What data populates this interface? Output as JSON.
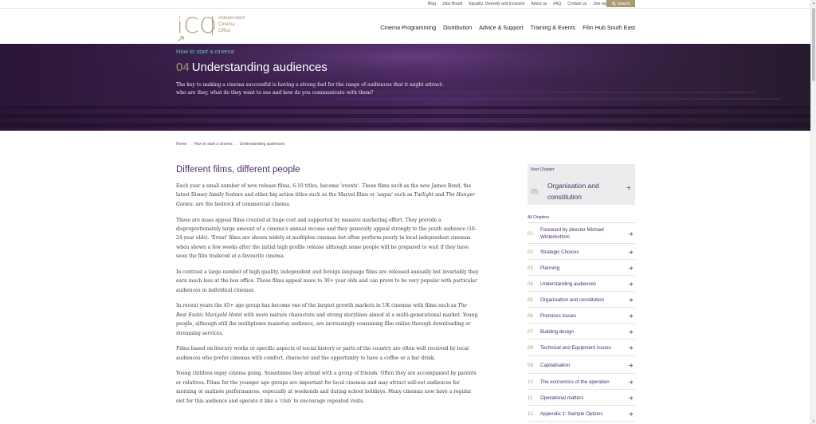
{
  "utility": {
    "links": [
      "Blog",
      "Jobs Board",
      "Equality, Diversity and Inclusion",
      "About us",
      "FAQ",
      "Contact us",
      "Join our Newsletter"
    ],
    "search_label": "Search"
  },
  "logo": {
    "mark": "iCO",
    "line1": "Independent",
    "line2": "Cinema",
    "line3": "Office"
  },
  "nav": [
    "Cinema Programming",
    "Distribution",
    "Advice & Support",
    "Training & Events",
    "Film Hub South East"
  ],
  "hero": {
    "section": "How to start a cinema",
    "number": "04",
    "title": "Understanding audiences",
    "description": "The key to making a cinema successful is having a strong feel for the range of audiences that it might attract: who are they, what do they want to see and how do you communicate with them?"
  },
  "breadcrumb": {
    "home": "Home",
    "section": "How to start a cinema",
    "current": "Understanding audiences",
    "arrow": "→"
  },
  "article": {
    "heading": "Different films, different people",
    "p1a": "Each year a small number of new release films, 6-10 titles, become 'events'.  These films such as the new James Bond, the latest Disney family feature and other big action titles such as the Marvel films or 'sagas' such as ",
    "p1_em1": "Twilight",
    "p1b": " and ",
    "p1_em2": "The Hunger Games",
    "p1c": ", are the bedrock of commercial cinema.",
    "p2": "These are mass appeal films created at huge cost and supported by massive marketing effort. They provide a disproportionately large amount of a cinema's annual income and they generally appeal strongly to the youth audience (16-24 year olds). 'Event' films are shown widely at multiplex cinemas but often perform poorly in local independent cinemas when shown a few weeks after the initial high profile release although some people will be prepared to wait if they have seen the film trailered at a favourite cinema.",
    "p3": "In contrast a large number of high quality, independent and foreign language films are released annually but invariably they earn much less at the box office. These films appeal more to 30+ year olds and can prove to be very popular with particular audiences in individual cinemas.",
    "p4a": "In recent years the 45+ age group has become one of the largest growth markets in UK cinemas with films such as ",
    "p4_em": "The Best Exotic Marigold Hotel",
    "p4b": " with more mature characters and strong storylines aimed at a multi-generational market. Young people, although still the multiplexes mainstay audience, are increasingly consuming film online through downloading or streaming services.",
    "p5": "Films based on literary works or specific aspects of social history or parts of the country are often well received by local audiences who prefer cinemas with comfort, character and the opportunity to have a coffee or a bar drink.",
    "p6": "Young children enjoy cinema going. Sometimes they attend with a group of friends. Often they are accompanied by parents or relatives. Films for the younger age groups are important for local cinemas and may attract sell-out audiences for morning or matinée performances, especially at weekends and during school holidays.  Many cinemas now have a regular slot for this audience and operate it like a 'club' to encourage repeated visits."
  },
  "next_chapter": {
    "label": "Next Chapter",
    "number": "05",
    "title": "Organisation and constitution"
  },
  "all_chapters": {
    "label": "All Chapters",
    "items": [
      {
        "num": "01",
        "title": "Foreword by director Michael Winterbottom"
      },
      {
        "num": "02",
        "title": "Strategic Choices"
      },
      {
        "num": "03",
        "title": "Planning"
      },
      {
        "num": "04",
        "title": "Understanding audiences"
      },
      {
        "num": "05",
        "title": "Organisation and constitution"
      },
      {
        "num": "06",
        "title": "Premises issues"
      },
      {
        "num": "07",
        "title": "Building design"
      },
      {
        "num": "08",
        "title": "Technical and Equipment Issues"
      },
      {
        "num": "09",
        "title": "Capitalisation"
      },
      {
        "num": "10",
        "title": "The economics of the operation"
      },
      {
        "num": "11",
        "title": "Operational matters"
      },
      {
        "num": "12",
        "title": "Appendix 1: Sample Options"
      }
    ]
  },
  "colors": {
    "brand_gold": "#a99a72",
    "brand_purple": "#4b2d6b",
    "accent_teal": "#5fc7c7",
    "hero_dark": "#2a1636"
  }
}
